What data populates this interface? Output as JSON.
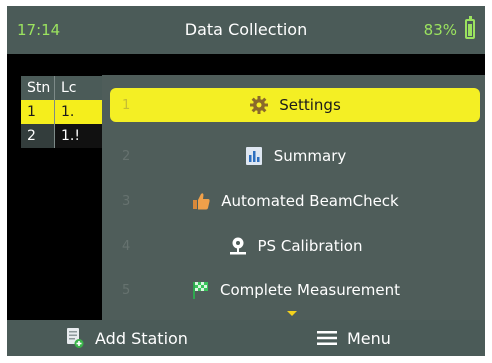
{
  "status_bar": {
    "time": "17:14",
    "title": "Data Collection",
    "battery": "83%"
  },
  "table": {
    "headers": [
      "Stn",
      "Lc"
    ],
    "rows": [
      [
        "1",
        "1."
      ],
      [
        "2",
        "1.!"
      ]
    ]
  },
  "menu": {
    "items": [
      {
        "number": "1",
        "label": "Settings",
        "icon": "gear-icon",
        "selected": true
      },
      {
        "number": "2",
        "label": "Summary",
        "icon": "summary-chart-icon",
        "selected": false
      },
      {
        "number": "3",
        "label": "Automated BeamCheck",
        "icon": "thumbs-up-icon",
        "selected": false
      },
      {
        "number": "4",
        "label": "PS Calibration",
        "icon": "calibration-icon",
        "selected": false
      },
      {
        "number": "5",
        "label": "Complete Measurement",
        "icon": "finish-flag-icon",
        "selected": false
      }
    ],
    "more_indicator": "chevron-down-icon"
  },
  "bottom_bar": {
    "add_station": "Add Station",
    "menu": "Menu"
  },
  "colors": {
    "status_green": "#9be35f",
    "highlight_yellow": "#f4ef24",
    "bar_gray": "#4b5b58",
    "popup_gray": "#4f5d5a"
  }
}
